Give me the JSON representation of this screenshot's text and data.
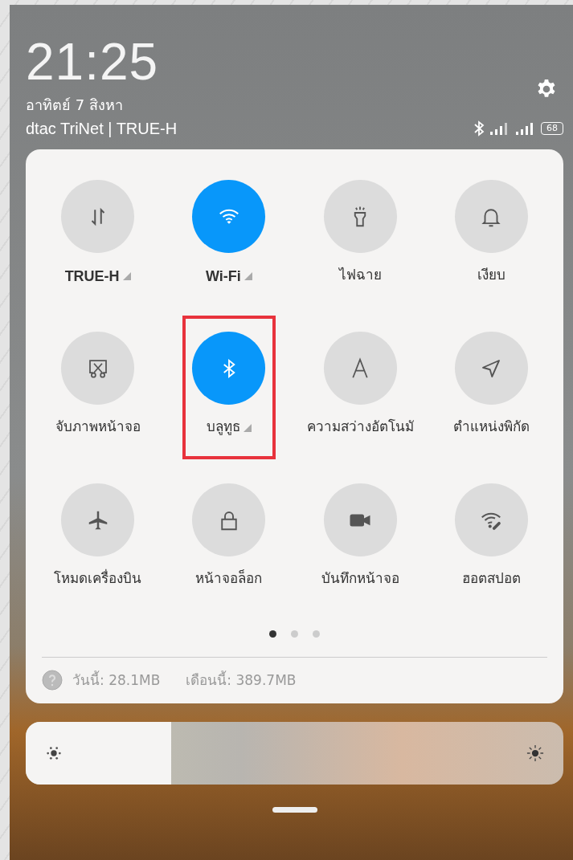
{
  "status": {
    "time": "21:25",
    "date": "อาทิตย์ 7 สิงหา",
    "carrier": "dtac TriNet | TRUE-H",
    "battery": "68"
  },
  "tiles": [
    {
      "kind": "data",
      "label": "TRUE-H",
      "on": false,
      "expandable": true,
      "highlighted": false
    },
    {
      "kind": "wifi",
      "label": "Wi-Fi",
      "on": true,
      "expandable": true,
      "highlighted": false
    },
    {
      "kind": "flashlight",
      "label": "ไฟฉาย",
      "on": false,
      "expandable": false,
      "highlighted": false
    },
    {
      "kind": "bell",
      "label": "เงียบ",
      "on": false,
      "expandable": false,
      "highlighted": false
    },
    {
      "kind": "screenshot",
      "label": "จับภาพหน้าจอ",
      "on": false,
      "expandable": false,
      "highlighted": false
    },
    {
      "kind": "bluetooth",
      "label": "บลูทูธ",
      "on": true,
      "expandable": true,
      "highlighted": true
    },
    {
      "kind": "brightness",
      "label": "ความสว่างอัตโนมั",
      "on": false,
      "expandable": false,
      "highlighted": false
    },
    {
      "kind": "location",
      "label": "ตำแหน่งพิกัด",
      "on": false,
      "expandable": false,
      "highlighted": false
    },
    {
      "kind": "airplane",
      "label": "โหมดเครื่องบิน",
      "on": false,
      "expandable": false,
      "highlighted": false
    },
    {
      "kind": "lock",
      "label": "หน้าจอล็อก",
      "on": false,
      "expandable": false,
      "highlighted": false
    },
    {
      "kind": "video",
      "label": "บันทึกหน้าจอ",
      "on": false,
      "expandable": false,
      "highlighted": false
    },
    {
      "kind": "hotspot",
      "label": "ฮอตสปอต",
      "on": false,
      "expandable": false,
      "highlighted": false
    }
  ],
  "pages": [
    {
      "selected": true
    },
    {
      "selected": false
    },
    {
      "selected": false
    }
  ],
  "data_usage": {
    "today": "วันนี้: 28.1MB",
    "month": "เดือนนี้: 389.7MB"
  },
  "brightness": {
    "level": 0.27
  }
}
